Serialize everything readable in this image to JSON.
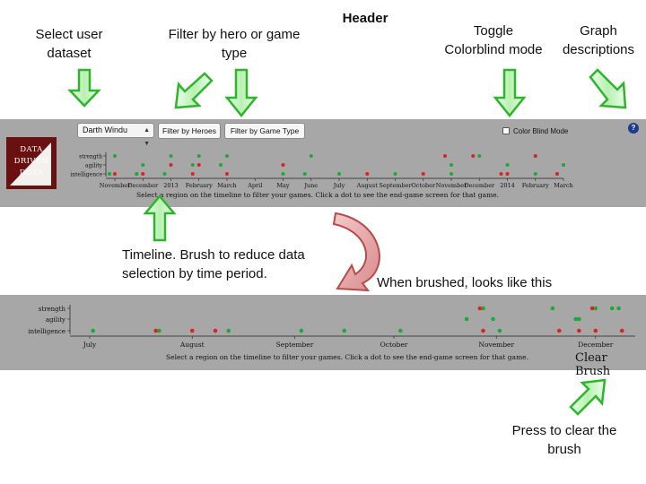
{
  "annotations": {
    "header": "Header",
    "select_user": [
      "Select user",
      "dataset"
    ],
    "filter": [
      "Filter by hero or game",
      "type"
    ],
    "toggle": [
      "Toggle",
      "Colorblind mode"
    ],
    "graph_desc": [
      "Graph",
      "descriptions"
    ],
    "timeline": [
      "Timeline. Brush to reduce data",
      "selection by time period."
    ],
    "brushed": "When brushed, looks like this",
    "clear": [
      "Press to clear the",
      "brush"
    ]
  },
  "app": {
    "logo_lines": [
      "DATA",
      "DRIVEN",
      "DOTA"
    ],
    "user_select_value": "Darth Windu",
    "filter_heroes_label": "Filter by Heroes",
    "filter_gametype_label": "Filter by Game Type",
    "colorblind_label": "Color Blind Mode",
    "colorblind_checked": false,
    "help_label": "?",
    "timeline_note": "Select a region on the timeline to filter your games. Click a dot to see the end-game screen for that game.",
    "clear_brush_label": "Clear Brush"
  },
  "colors": {
    "panel": "#a7a7a7",
    "win": "#1fa83a",
    "loss": "#d42626",
    "arrow_green": "#2db52d",
    "arrow_red": "#d46a6a"
  },
  "chart_data": [
    {
      "type": "scatter",
      "title": "",
      "categories": [
        "strength",
        "agility",
        "intelligence"
      ],
      "x_ticks": [
        "November",
        "December",
        "2013",
        "February",
        "March",
        "April",
        "May",
        "June",
        "July",
        "August",
        "September",
        "October",
        "November",
        "December",
        "2014",
        "February",
        "March"
      ],
      "series": [
        {
          "name": "",
          "color": "win",
          "points": [
            [
              "Nov",
              "strength"
            ],
            [
              "Nov",
              "intelligence"
            ],
            [
              "Dec",
              "agility"
            ],
            [
              "Dec",
              "intelligence"
            ],
            [
              "Jan",
              "strength"
            ],
            [
              "Jan",
              "intelligence"
            ],
            [
              "Feb",
              "strength"
            ],
            [
              "Feb",
              "agility"
            ],
            [
              "Mar",
              "strength"
            ],
            [
              "Mar",
              "agility"
            ],
            [
              "Apr",
              "intelligence"
            ],
            [
              "May",
              "strength"
            ],
            [
              "May",
              "intelligence"
            ],
            [
              "Jun",
              "intelligence"
            ],
            [
              "Aug",
              "intelligence"
            ],
            [
              "Oct",
              "intelligence"
            ],
            [
              "Nov",
              "agility"
            ],
            [
              "Dec",
              "strength"
            ],
            [
              "Dec",
              "intelligence"
            ],
            [
              "Jan",
              "agility"
            ],
            [
              "Feb",
              "intelligence"
            ],
            [
              "Mar",
              "agility"
            ],
            [
              "Mar",
              "intelligence"
            ]
          ]
        },
        {
          "name": "",
          "color": "loss",
          "points": [
            [
              "Nov",
              "intelligence"
            ],
            [
              "Dec",
              "intelligence"
            ],
            [
              "Jan",
              "agility"
            ],
            [
              "Jan",
              "intelligence"
            ],
            [
              "Feb",
              "agility"
            ],
            [
              "Feb",
              "intelligence"
            ],
            [
              "Mar",
              "intelligence"
            ],
            [
              "Apr",
              "agility"
            ],
            [
              "Jul",
              "intelligence"
            ],
            [
              "Sep",
              "intelligence"
            ],
            [
              "Nov",
              "strength"
            ],
            [
              "Dec",
              "strength"
            ],
            [
              "Jan",
              "intelligence"
            ],
            [
              "Feb",
              "strength"
            ],
            [
              "Mar",
              "intelligence"
            ]
          ]
        }
      ]
    },
    {
      "type": "scatter",
      "title": "",
      "categories": [
        "strength",
        "agility",
        "intelligence"
      ],
      "x_ticks": [
        "July",
        "August",
        "September",
        "October",
        "November",
        "December"
      ],
      "series": [
        {
          "name": "",
          "color": "win",
          "points": [
            [
              "Jul 02",
              "intelligence"
            ],
            [
              "Jul 22",
              "intelligence"
            ],
            [
              "Aug 12",
              "intelligence"
            ],
            [
              "Sep 03",
              "intelligence"
            ],
            [
              "Sep 16",
              "intelligence"
            ],
            [
              "Oct 03",
              "intelligence"
            ],
            [
              "Oct 23",
              "agility"
            ],
            [
              "Oct 28",
              "strength"
            ],
            [
              "Oct 31",
              "agility"
            ],
            [
              "Nov 02",
              "intelligence"
            ],
            [
              "Nov 18",
              "strength"
            ],
            [
              "Nov 25",
              "agility"
            ],
            [
              "Nov 26",
              "agility"
            ],
            [
              "Dec 01",
              "strength"
            ],
            [
              "Dec 06",
              "strength"
            ],
            [
              "Dec 08",
              "strength"
            ]
          ]
        },
        {
          "name": "",
          "color": "loss",
          "points": [
            [
              "Jul 21",
              "intelligence"
            ],
            [
              "Aug 01",
              "intelligence"
            ],
            [
              "Aug 08",
              "intelligence"
            ],
            [
              "Oct 27",
              "strength"
            ],
            [
              "Oct 28",
              "intelligence"
            ],
            [
              "Nov 20",
              "intelligence"
            ],
            [
              "Nov 26",
              "intelligence"
            ],
            [
              "Nov 30",
              "strength"
            ],
            [
              "Dec 01",
              "intelligence"
            ],
            [
              "Dec 09",
              "intelligence"
            ]
          ]
        }
      ]
    }
  ]
}
